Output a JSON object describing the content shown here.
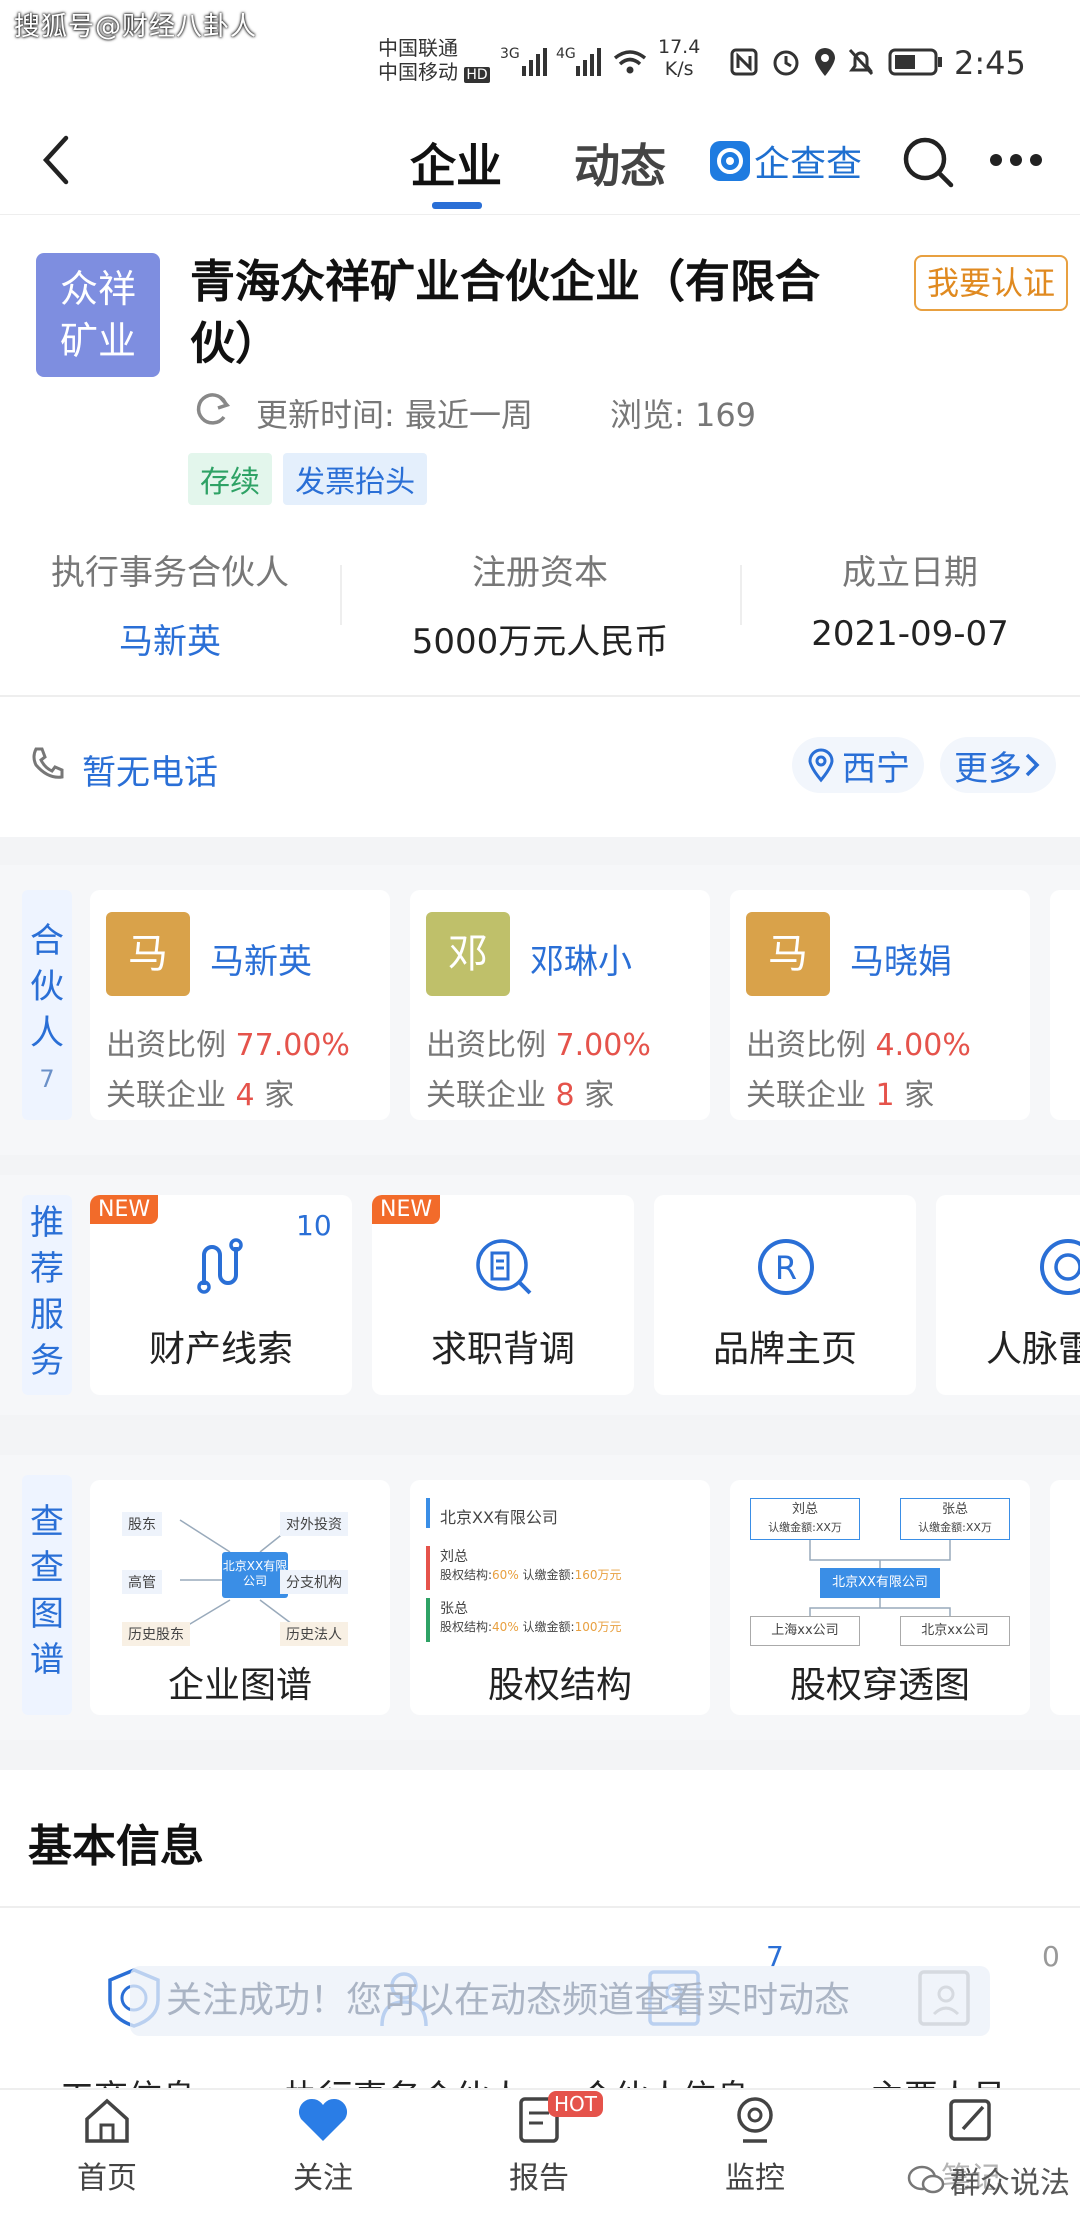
{
  "status_bar": {
    "watermark": "搜狐号@财经八卦人",
    "carrier1": "中国联通",
    "carrier2": "中国移动",
    "hd": "HD",
    "signal1": "3G",
    "signal2": "4G",
    "speed_value": "17.4",
    "speed_unit": "K/s",
    "time": "2:45"
  },
  "nav": {
    "tab_company": "企业",
    "tab_dynamic": "动态",
    "brand": "企查查"
  },
  "company": {
    "logo_line1": "众祥",
    "logo_line2": "矿业",
    "name_line1": "青海众祥矿业合伙企业（有限合",
    "name_line2": "伙）",
    "verify_button": "我要认证",
    "update_label": "更新时间: 最近一周",
    "views_label": "浏览: 169",
    "tag_status": "存续",
    "tag_invoice": "发票抬头"
  },
  "stats": [
    {
      "label": "执行事务合伙人",
      "value": "马新英"
    },
    {
      "label": "注册资本",
      "value": "5000万元人民币"
    },
    {
      "label": "成立日期",
      "value": "2021-09-07"
    }
  ],
  "contact": {
    "phone": "暂无电话",
    "city": "西宁",
    "more": "更多"
  },
  "partners": {
    "side_label": [
      "合",
      "伙",
      "人"
    ],
    "count": "7",
    "items": [
      {
        "avatar": "马",
        "name": "马新英",
        "ratio_label": "出资比例",
        "ratio": "77.00%",
        "related_label": "关联企业",
        "related_count": "4",
        "related_unit": "家",
        "color": "#d9a24a"
      },
      {
        "avatar": "邓",
        "name": "邓琳小",
        "ratio_label": "出资比例",
        "ratio": "7.00%",
        "related_label": "关联企业",
        "related_count": "8",
        "related_unit": "家",
        "color": "#bfc06a"
      },
      {
        "avatar": "马",
        "name": "马晓娟",
        "ratio_label": "出资比例",
        "ratio": "4.00%",
        "related_label": "关联企业",
        "related_count": "1",
        "related_unit": "家",
        "color": "#d9a24a"
      }
    ]
  },
  "services": {
    "side_label": [
      "推",
      "荐",
      "服",
      "务"
    ],
    "items": [
      {
        "label": "财产线索",
        "badge": "NEW",
        "count": "10",
        "icon": "asset-clue-icon"
      },
      {
        "label": "求职背调",
        "badge": "NEW",
        "count": "",
        "icon": "background-check-icon"
      },
      {
        "label": "品牌主页",
        "badge": "",
        "count": "",
        "icon": "brand-registered-icon"
      },
      {
        "label": "人脉雷",
        "badge": "",
        "count": "",
        "icon": "network-radar-icon"
      }
    ]
  },
  "graphs": {
    "side_label": [
      "查",
      "查",
      "图",
      "谱"
    ],
    "items": [
      {
        "label": "企业图谱"
      },
      {
        "label": "股权结构"
      },
      {
        "label": "股权穿透图"
      }
    ],
    "map_nodes": {
      "center": "北京XX有限公司",
      "n1": "股东",
      "n2": "对外投资",
      "n3": "高管",
      "n4": "分支机构",
      "n5": "历史股东",
      "n6": "历史法人"
    },
    "equity": {
      "company": "北京XX有限公司",
      "p1": "刘总",
      "p1_ratio_label": "股权结构:",
      "p1_ratio": "60%",
      "p1_amt_label": "认缴金额:",
      "p1_amt": "160万元",
      "p2": "张总",
      "p2_ratio_label": "股权结构:",
      "p2_ratio": "40%",
      "p2_amt_label": "认缴金额:",
      "p2_amt": "100万元"
    },
    "penetrate": {
      "p1": "刘总",
      "p1_sub": "认缴金额:XX万",
      "p2": "张总",
      "p2_sub": "认缴金额:XX万",
      "center": "北京XX有限公司",
      "c1": "上海xx公司",
      "c2": "北京xx公司"
    }
  },
  "basic": {
    "title": "基本信息",
    "toast": "关注成功！您可以在动态频道查看实时动态",
    "count1": "7",
    "count2": "0",
    "items": [
      "工商信息",
      "执行事务合伙人",
      "合伙人信息",
      "主要人员"
    ]
  },
  "bottom_nav": {
    "items": [
      {
        "label": "首页",
        "icon": "home-icon"
      },
      {
        "label": "关注",
        "icon": "heart-icon"
      },
      {
        "label": "报告",
        "icon": "report-icon",
        "badge": "HOT"
      },
      {
        "label": "监控",
        "icon": "monitor-icon"
      },
      {
        "label": "笔记",
        "icon": "note-icon"
      }
    ],
    "watermark": "群众说法"
  },
  "colors": {
    "accent": "#2a6fd6",
    "orange": "#e8a040",
    "red": "#e5534b",
    "green_tag_bg": "#e3f6ec",
    "blue_tag_bg": "#e4effc"
  }
}
